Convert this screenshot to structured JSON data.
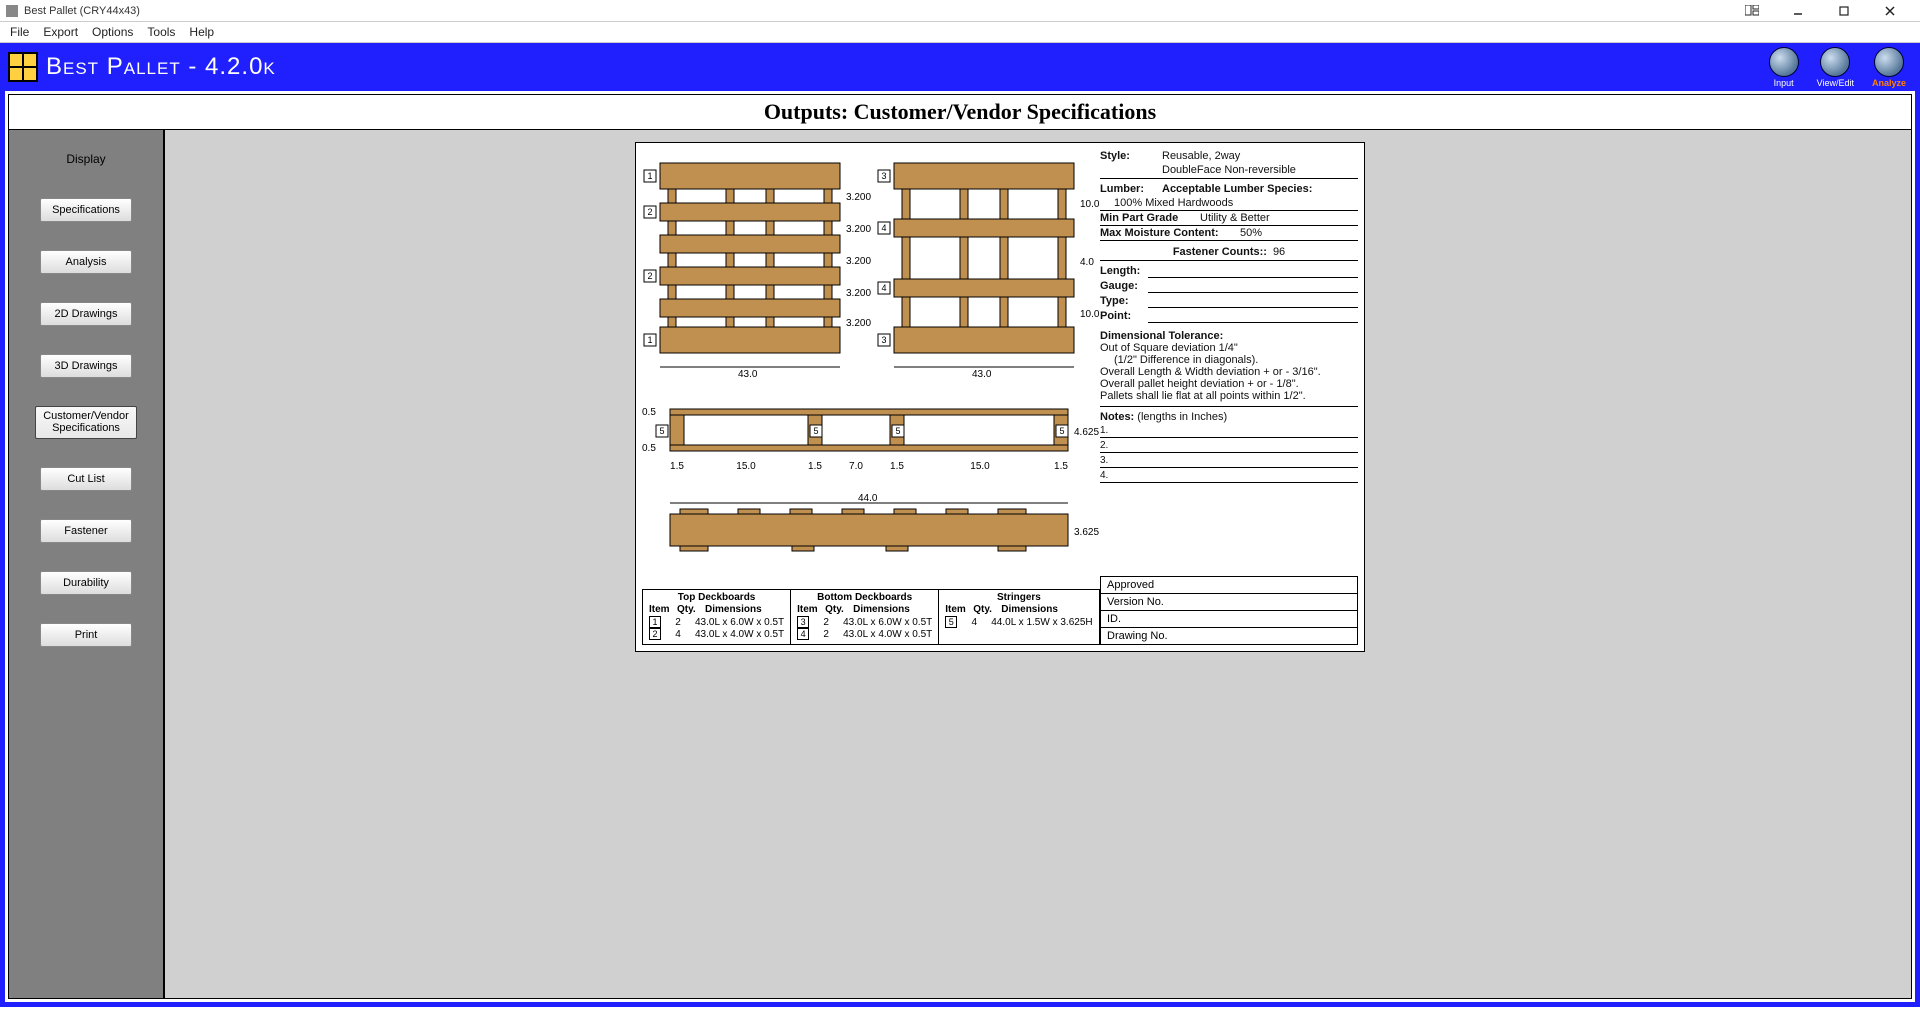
{
  "window": {
    "title": "Best Pallet (CRY44x43)"
  },
  "menu": {
    "file": "File",
    "export": "Export",
    "options": "Options",
    "tools": "Tools",
    "help": "Help"
  },
  "brand": {
    "title": "Best Pallet - 4.2.0k",
    "input": "Input",
    "viewedit": "View/Edit",
    "analyze": "Analyze"
  },
  "page": {
    "title": "Outputs: Customer/Vendor Specifications"
  },
  "sidebar": {
    "header": "Display",
    "specifications": "Specifications",
    "analysis": "Analysis",
    "d2": "2D Drawings",
    "d3": "3D Drawings",
    "cvspec": "Customer/Vendor Specifications",
    "cutlist": "Cut List",
    "fastener": "Fastener",
    "durability": "Durability",
    "print": "Print"
  },
  "spec": {
    "style_lbl": "Style:",
    "style_val": "Reusable, 2way",
    "style_val2": "DoubleFace Non-reversible",
    "lumber_lbl": "Lumber:",
    "lumber_hdr": "Acceptable Lumber Species:",
    "lumber_val": "100% Mixed Hardwoods",
    "mingrade_lbl": "Min Part Grade",
    "mingrade_val": "Utility & Better",
    "moisture_lbl": "Max Moisture Content:",
    "moisture_val": "50%",
    "fastener_lbl": "Fastener Counts::",
    "fastener_val": "96",
    "length_lbl": "Length:",
    "gauge_lbl": "Gauge:",
    "type_lbl": "Type:",
    "point_lbl": "Point:",
    "dimtol_hdr": "Dimensional Tolerance:",
    "dimtol_1": "Out of Square deviation 1/4\"",
    "dimtol_2": "(1/2\" Difference in diagonals).",
    "dimtol_3": "Overall Length & Width deviation + or - 3/16\".",
    "dimtol_4": "Overall pallet height deviation + or - 1/8\".",
    "dimtol_5": "Pallets shall lie flat at all points within 1/2\".",
    "notes_lbl": "Notes:",
    "notes_sub": "(lengths in Inches)"
  },
  "titleboxes": {
    "approved": "Approved",
    "version": "Version No.",
    "id": "ID.",
    "drawing": "Drawing No."
  },
  "parts": {
    "top_hdr": "Top Deckboards",
    "bot_hdr": "Bottom Deckboards",
    "str_hdr": "Stringers",
    "col_item": "Item",
    "col_qty": "Qty.",
    "col_dim": "Dimensions",
    "top": [
      {
        "item": "1",
        "qty": "2",
        "dim": "43.0L x 6.0W x 0.5T"
      },
      {
        "item": "2",
        "qty": "4",
        "dim": "43.0L x 4.0W x 0.5T"
      }
    ],
    "bot": [
      {
        "item": "3",
        "qty": "2",
        "dim": "43.0L x 6.0W x 0.5T"
      },
      {
        "item": "4",
        "qty": "2",
        "dim": "43.0L x 4.0W x 0.5T"
      }
    ],
    "str": [
      {
        "item": "5",
        "qty": "4",
        "dim": "44.0L x 1.5W x 3.625H"
      }
    ]
  },
  "dims": {
    "top_width": "43.0",
    "bot_width": "43.0",
    "top_gap": "3.200",
    "side_top": "10.0",
    "side_mid": "4.0",
    "side_bot": "10.0",
    "side_ht": "4.625",
    "deck": "0.5",
    "front_len": "44.0",
    "front_ht": "3.625",
    "front_segs": [
      "1.5",
      "15.0",
      "1.5",
      "7.0",
      "1.5",
      "15.0",
      "1.5"
    ]
  }
}
